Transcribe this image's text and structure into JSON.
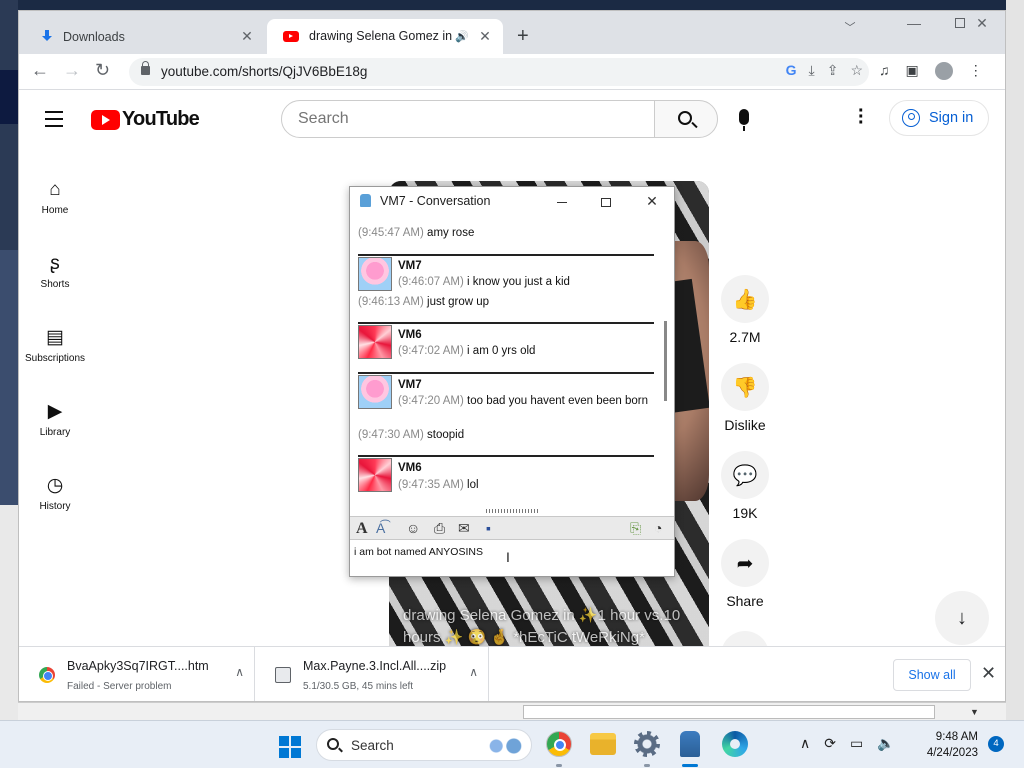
{
  "browser": {
    "tabs": [
      {
        "title": "Downloads"
      },
      {
        "title": "drawing Selena Gomez in ✨"
      }
    ],
    "url": "youtube.com/shorts/QjJV6BbE18g"
  },
  "youtube": {
    "logo_text": "YouTube",
    "search_placeholder": "Search",
    "signin_label": "Sign in",
    "sidebar": [
      {
        "label": "Home",
        "icon": "home-icon"
      },
      {
        "label": "Shorts",
        "icon": "shorts-icon"
      },
      {
        "label": "Subscriptions",
        "icon": "subscriptions-icon"
      },
      {
        "label": "Library",
        "icon": "library-icon"
      },
      {
        "label": "History",
        "icon": "history-icon"
      }
    ],
    "video_caption": "drawing Selena Gomez in ✨1 hour vs.10 hours ✨ 😳 🤞 *hEcTiC tWeRkiNg*",
    "actions": {
      "likes": "2.7M",
      "dislike_label": "Dislike",
      "comments": "19K",
      "share_label": "Share"
    }
  },
  "im_window": {
    "title": "VM7 - Conversation",
    "messages": [
      {
        "time": "(9:45:47 AM)",
        "text": "amy rose"
      },
      {
        "user": "VM7",
        "time": "(9:46:07 AM)",
        "text": "i know you just a kid",
        "avatar": "amy"
      },
      {
        "time": "(9:46:13 AM)",
        "text": "just grow up"
      },
      {
        "user": "VM6",
        "time": "(9:47:02 AM)",
        "text": "i am 0 yrs old",
        "avatar": "star"
      },
      {
        "user": "VM7",
        "time": "(9:47:20 AM)",
        "text": "too bad you havent even been born",
        "avatar": "amy"
      },
      {
        "time": "(9:47:30 AM)",
        "text": "stoopid"
      },
      {
        "user": "VM6",
        "time": "(9:47:35 AM)",
        "text": "lol",
        "avatar": "star"
      }
    ],
    "input_text": "i am bot named ANYOSINS"
  },
  "downloads": {
    "items": [
      {
        "name": "BvaApky3Sq7IRGT....htm",
        "status": "Failed - Server problem"
      },
      {
        "name": "Max.Payne.3.Incl.All....zip",
        "status": "5.1/30.5 GB, 45 mins left"
      }
    ],
    "show_all_label": "Show all"
  },
  "taskbar": {
    "search_label": "Search",
    "time": "9:48 AM",
    "date": "4/24/2023",
    "notification_count": "4"
  }
}
